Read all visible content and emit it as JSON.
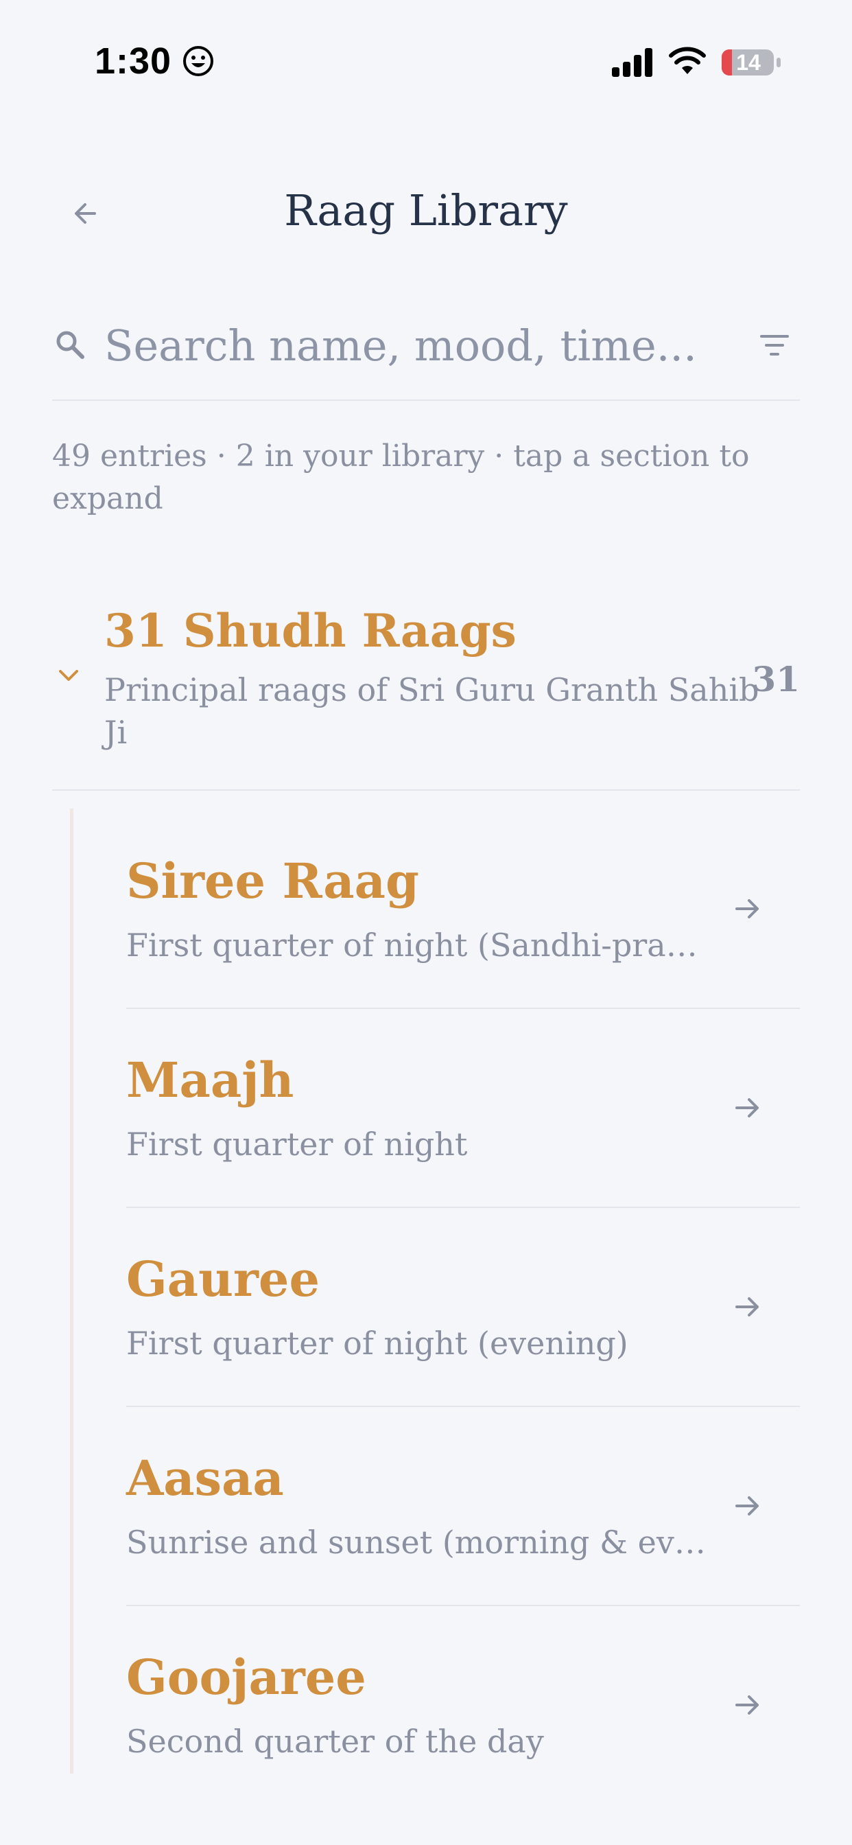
{
  "status_bar": {
    "time": "1:30",
    "battery": "14",
    "icons": [
      "emoji-icon",
      "signal-icon",
      "wifi-icon",
      "battery-icon"
    ]
  },
  "header": {
    "title": "Raag Library",
    "back_icon": "back-arrow-icon"
  },
  "search": {
    "placeholder": "Search name, mood, time...",
    "value": "",
    "search_icon": "search-icon",
    "filter_icon": "filter-icon"
  },
  "summary": "49 entries · 2 in your library · tap a section to expand",
  "section": {
    "title": "31 Shudh Raags",
    "subtitle": "Principal raags of Sri Guru Granth Sahib Ji",
    "count": "31",
    "chevron_icon": "chevron-down-icon"
  },
  "raags": [
    {
      "name": "Siree Raag",
      "description": "First quarter of night (Sandhi-praka..."
    },
    {
      "name": "Maajh",
      "description": "First quarter of night"
    },
    {
      "name": "Gauree",
      "description": "First quarter of night (evening)"
    },
    {
      "name": "Aasaa",
      "description": "Sunrise and sunset (morning & even..."
    },
    {
      "name": "Goojaree",
      "description": "Second quarter of the day"
    }
  ],
  "colors": {
    "background": "#f5f6f9",
    "accent": "#cf8f3f",
    "title": "#263248",
    "muted": "#8a90a0",
    "divider": "#e2e5ec",
    "battery_low": "#e5484d"
  }
}
